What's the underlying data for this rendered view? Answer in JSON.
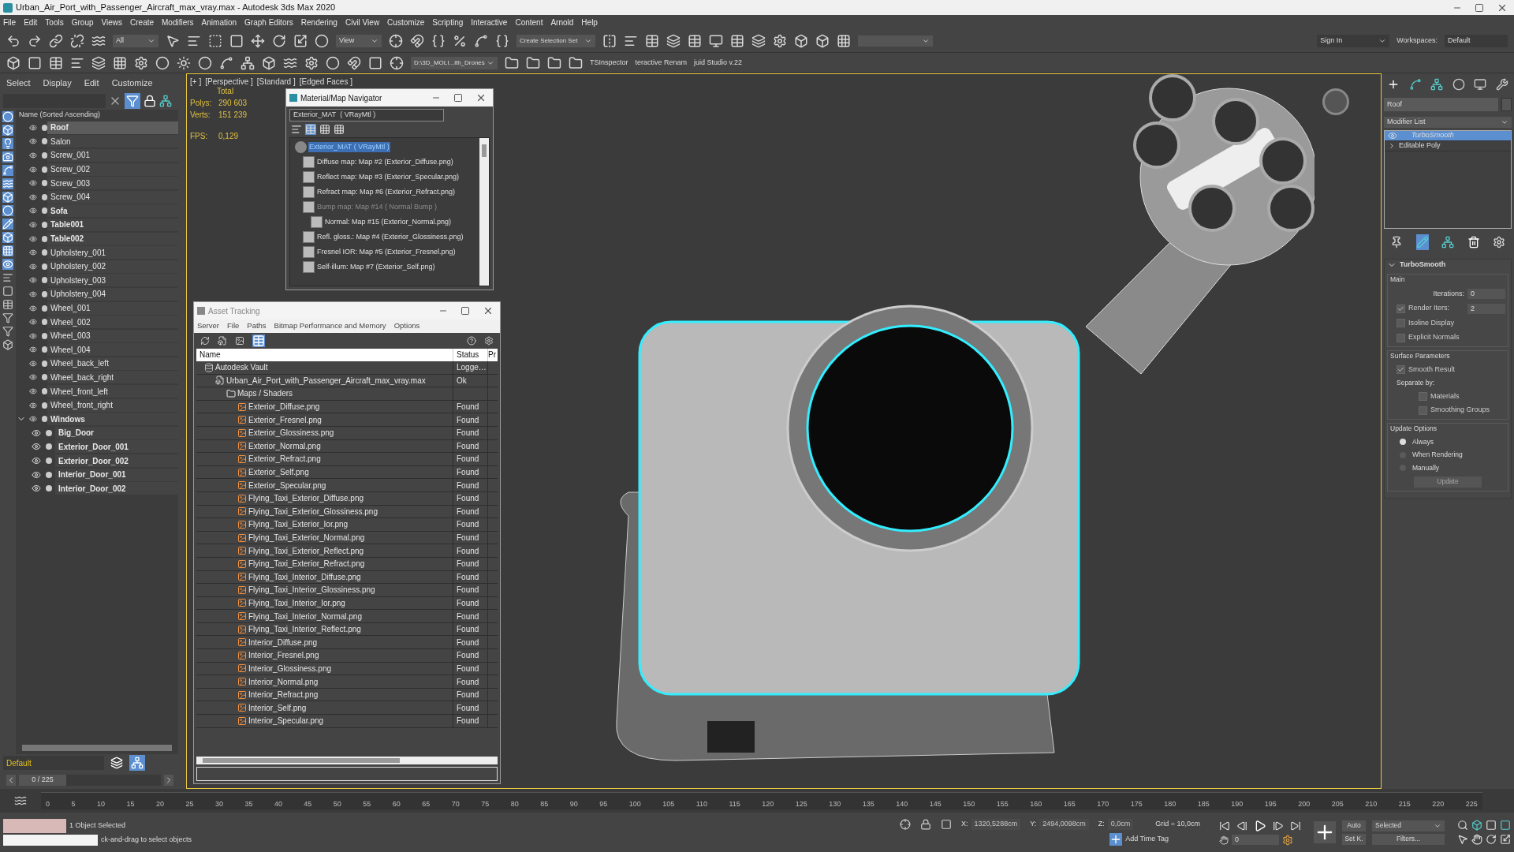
{
  "window": {
    "title": "Urban_Air_Port_with_Passenger_Aircraft_max_vray.max - Autodesk 3ds Max 2020"
  },
  "menu": [
    "File",
    "Edit",
    "Tools",
    "Group",
    "Views",
    "Create",
    "Modifiers",
    "Animation",
    "Graph Editors",
    "Rendering",
    "Civil View",
    "Customize",
    "Scripting",
    "Interactive",
    "Content",
    "Arnold",
    "Help"
  ],
  "toolbar": {
    "selection_filter": "All",
    "reference_coord": "View",
    "selection_set": "Create Selection Set",
    "sign_in": "Sign In",
    "workspaces_label": "Workspaces:",
    "workspace": "Default",
    "project_path": "D:\\3D_MOLI...ith_Drones",
    "scripts": [
      "TSInspector",
      "teractive Renam",
      "juid Studio v.22"
    ]
  },
  "scene_explorer": {
    "menu": [
      "Select",
      "Display",
      "Edit",
      "Customize"
    ],
    "column": "Name (Sorted Ascending)",
    "items": [
      {
        "name": "Roof",
        "bold": true,
        "selected": true
      },
      {
        "name": "Salon",
        "bold": false,
        "selected": false
      },
      {
        "name": "Screw_001",
        "bold": false,
        "selected": false
      },
      {
        "name": "Screw_002",
        "bold": false,
        "selected": false
      },
      {
        "name": "Screw_003",
        "bold": false,
        "selected": false
      },
      {
        "name": "Screw_004",
        "bold": false,
        "selected": false
      },
      {
        "name": "Sofa",
        "bold": true,
        "selected": false
      },
      {
        "name": "Table001",
        "bold": true,
        "selected": false
      },
      {
        "name": "Table002",
        "bold": true,
        "selected": false
      },
      {
        "name": "Upholstery_001",
        "bold": false,
        "selected": false
      },
      {
        "name": "Upholstery_002",
        "bold": false,
        "selected": false
      },
      {
        "name": "Upholstery_003",
        "bold": false,
        "selected": false
      },
      {
        "name": "Upholstery_004",
        "bold": false,
        "selected": false
      },
      {
        "name": "Wheel_001",
        "bold": false,
        "selected": false
      },
      {
        "name": "Wheel_002",
        "bold": false,
        "selected": false
      },
      {
        "name": "Wheel_003",
        "bold": false,
        "selected": false
      },
      {
        "name": "Wheel_004",
        "bold": false,
        "selected": false
      },
      {
        "name": "Wheel_back_left",
        "bold": false,
        "selected": false
      },
      {
        "name": "Wheel_back_right",
        "bold": false,
        "selected": false
      },
      {
        "name": "Wheel_front_left",
        "bold": false,
        "selected": false
      },
      {
        "name": "Wheel_front_right",
        "bold": false,
        "selected": false
      },
      {
        "name": "Windows",
        "bold": true,
        "selected": false,
        "expanded": true,
        "children": [
          {
            "name": "Big_Door",
            "bold": true,
            "selected": false
          },
          {
            "name": "Exterior_Door_001",
            "bold": true,
            "selected": false
          },
          {
            "name": "Exterior_Door_002",
            "bold": true,
            "selected": false
          },
          {
            "name": "Interior_Door_001",
            "bold": true,
            "selected": false
          },
          {
            "name": "Interior_Door_002",
            "bold": true,
            "selected": false
          }
        ]
      }
    ],
    "layer": "Default",
    "time_slider": {
      "label": "0 / 225",
      "level": 0
    }
  },
  "viewport": {
    "labels": [
      "[+ ]",
      "[Perspective ]",
      "[Standard ]",
      "[Edged Faces ]"
    ],
    "stats_header": "Total",
    "stats": [
      {
        "label": "Polys:",
        "value": "290 603"
      },
      {
        "label": "Verts:",
        "value": "151 239"
      },
      {
        "label": "FPS:",
        "value": "0,129"
      }
    ]
  },
  "material_navigator": {
    "title": "Material/Map Navigator",
    "field": "Exterior_MAT  ( VRayMtl )",
    "root": {
      "label": "Exterior_MAT  ( VRayMtl )",
      "selected": true,
      "children": [
        {
          "label": "Diffuse map: Map #2 (Exterior_Diffuse.png)",
          "disabled": false
        },
        {
          "label": "Reflect map: Map #3 (Exterior_Specular.png)",
          "disabled": false
        },
        {
          "label": "Refract map: Map #6 (Exterior_Refract.png)",
          "disabled": false
        },
        {
          "label": "Bump map: Map #14  ( Normal Bump )",
          "disabled": true,
          "children": [
            {
              "label": "Normal: Map #15 (Exterior_Normal.png)",
              "disabled": false
            }
          ]
        },
        {
          "label": "Refl. gloss.: Map #4 (Exterior_Glossiness.png)",
          "disabled": false
        },
        {
          "label": "Fresnel IOR: Map #5 (Exterior_Fresnel.png)",
          "disabled": false
        },
        {
          "label": "Self-illum: Map #7 (Exterior_Self.png)",
          "disabled": false
        }
      ]
    }
  },
  "asset_tracking": {
    "title": "Asset Tracking",
    "menu": [
      "Server",
      "File",
      "Paths",
      "Bitmap Performance and Memory",
      "Options"
    ],
    "columns": [
      "Name",
      "Status",
      "Pr"
    ],
    "rows": [
      {
        "name": "Autodesk Vault",
        "status": "Logge…",
        "kind": "vault",
        "children": [
          {
            "name": "Urban_Air_Port_with_Passenger_Aircraft_max_vray.max",
            "status": "Ok",
            "kind": "scene",
            "children": [
              {
                "name": "Maps / Shaders",
                "kind": "folder",
                "children": [
                  {
                    "name": "Exterior_Diffuse.png",
                    "status": "Found",
                    "kind": "image"
                  },
                  {
                    "name": "Exterior_Fresnel.png",
                    "status": "Found",
                    "kind": "image"
                  },
                  {
                    "name": "Exterior_Glossiness.png",
                    "status": "Found",
                    "kind": "image"
                  },
                  {
                    "name": "Exterior_Normal.png",
                    "status": "Found",
                    "kind": "image"
                  },
                  {
                    "name": "Exterior_Refract.png",
                    "status": "Found",
                    "kind": "image"
                  },
                  {
                    "name": "Exterior_Self.png",
                    "status": "Found",
                    "kind": "image"
                  },
                  {
                    "name": "Exterior_Specular.png",
                    "status": "Found",
                    "kind": "image"
                  },
                  {
                    "name": "Flying_Taxi_Exterior_Diffuse.png",
                    "status": "Found",
                    "kind": "image"
                  },
                  {
                    "name": "Flying_Taxi_Exterior_Glossiness.png",
                    "status": "Found",
                    "kind": "image"
                  },
                  {
                    "name": "Flying_Taxi_Exterior_Ior.png",
                    "status": "Found",
                    "kind": "image"
                  },
                  {
                    "name": "Flying_Taxi_Exterior_Normal.png",
                    "status": "Found",
                    "kind": "image"
                  },
                  {
                    "name": "Flying_Taxi_Exterior_Reflect.png",
                    "status": "Found",
                    "kind": "image"
                  },
                  {
                    "name": "Flying_Taxi_Exterior_Refract.png",
                    "status": "Found",
                    "kind": "image"
                  },
                  {
                    "name": "Flying_Taxi_Interior_Diffuse.png",
                    "status": "Found",
                    "kind": "image"
                  },
                  {
                    "name": "Flying_Taxi_Interior_Glossiness.png",
                    "status": "Found",
                    "kind": "image"
                  },
                  {
                    "name": "Flying_Taxi_Interior_Ior.png",
                    "status": "Found",
                    "kind": "image"
                  },
                  {
                    "name": "Flying_Taxi_Interior_Normal.png",
                    "status": "Found",
                    "kind": "image"
                  },
                  {
                    "name": "Flying_Taxi_Interior_Reflect.png",
                    "status": "Found",
                    "kind": "image"
                  },
                  {
                    "name": "Interior_Diffuse.png",
                    "status": "Found",
                    "kind": "image"
                  },
                  {
                    "name": "Interior_Fresnel.png",
                    "status": "Found",
                    "kind": "image"
                  },
                  {
                    "name": "Interior_Glossiness.png",
                    "status": "Found",
                    "kind": "image"
                  },
                  {
                    "name": "Interior_Normal.png",
                    "status": "Found",
                    "kind": "image"
                  },
                  {
                    "name": "Interior_Refract.png",
                    "status": "Found",
                    "kind": "image"
                  },
                  {
                    "name": "Interior_Self.png",
                    "status": "Found",
                    "kind": "image"
                  },
                  {
                    "name": "Interior_Specular.png",
                    "status": "Found",
                    "kind": "image"
                  }
                ]
              }
            ]
          }
        ]
      }
    ]
  },
  "command_panel": {
    "object_name": "Roof",
    "modifier_list": "Modifier List",
    "stack": [
      {
        "name": "TurboSmooth",
        "kind": "modifier",
        "selected": true
      },
      {
        "name": "Editable Poly",
        "kind": "base",
        "selected": false
      }
    ],
    "rollout": {
      "title": "TurboSmooth",
      "main": {
        "title": "Main",
        "iterations_label": "Iterations:",
        "iterations": "0",
        "render_iters_label": "Render Iters:",
        "render_iters_checked": true,
        "render_iters": "2",
        "checks": [
          {
            "label": "Isoline Display",
            "checked": false
          },
          {
            "label": "Explicit Normals",
            "checked": false
          }
        ]
      },
      "surface": {
        "title": "Surface Parameters",
        "smooth": {
          "label": "Smooth Result",
          "checked": true
        },
        "separate_label": "Separate by:",
        "separate": [
          {
            "label": "Materials",
            "checked": false
          },
          {
            "label": "Smoothing Groups",
            "checked": false
          }
        ]
      },
      "update": {
        "title": "Update Options",
        "options": [
          {
            "label": "Always",
            "selected": true
          },
          {
            "label": "When Rendering",
            "selected": false
          },
          {
            "label": "Manually",
            "selected": false
          }
        ],
        "button": "Update"
      }
    }
  },
  "timeline": {
    "ticks": [
      "0",
      "5",
      "10",
      "15",
      "20",
      "25",
      "30",
      "35",
      "40",
      "45",
      "50",
      "55",
      "60",
      "65",
      "70",
      "75",
      "80",
      "85",
      "90",
      "95",
      "100",
      "105",
      "110",
      "115",
      "120",
      "125",
      "130",
      "135",
      "140",
      "145",
      "150",
      "155",
      "160",
      "165",
      "170",
      "175",
      "180",
      "185",
      "190",
      "195",
      "200",
      "205",
      "210",
      "215",
      "220",
      "225"
    ]
  },
  "status_bar": {
    "selection": "1 Object Selected",
    "prompt": "ck-and-drag to select objects",
    "coords": [
      {
        "label": "X:",
        "value": "1320,5288cm"
      },
      {
        "label": "Y:",
        "value": "2494,0098cm"
      },
      {
        "label": "Z:",
        "value": "0,0cm"
      }
    ],
    "grid": "Grid = 10,0cm",
    "add_time_tag": "Add Time Tag",
    "auto_key": "Auto",
    "set_key": "Set K.",
    "key_filter": "Selected",
    "filters": "Filters...",
    "frame": "0"
  }
}
